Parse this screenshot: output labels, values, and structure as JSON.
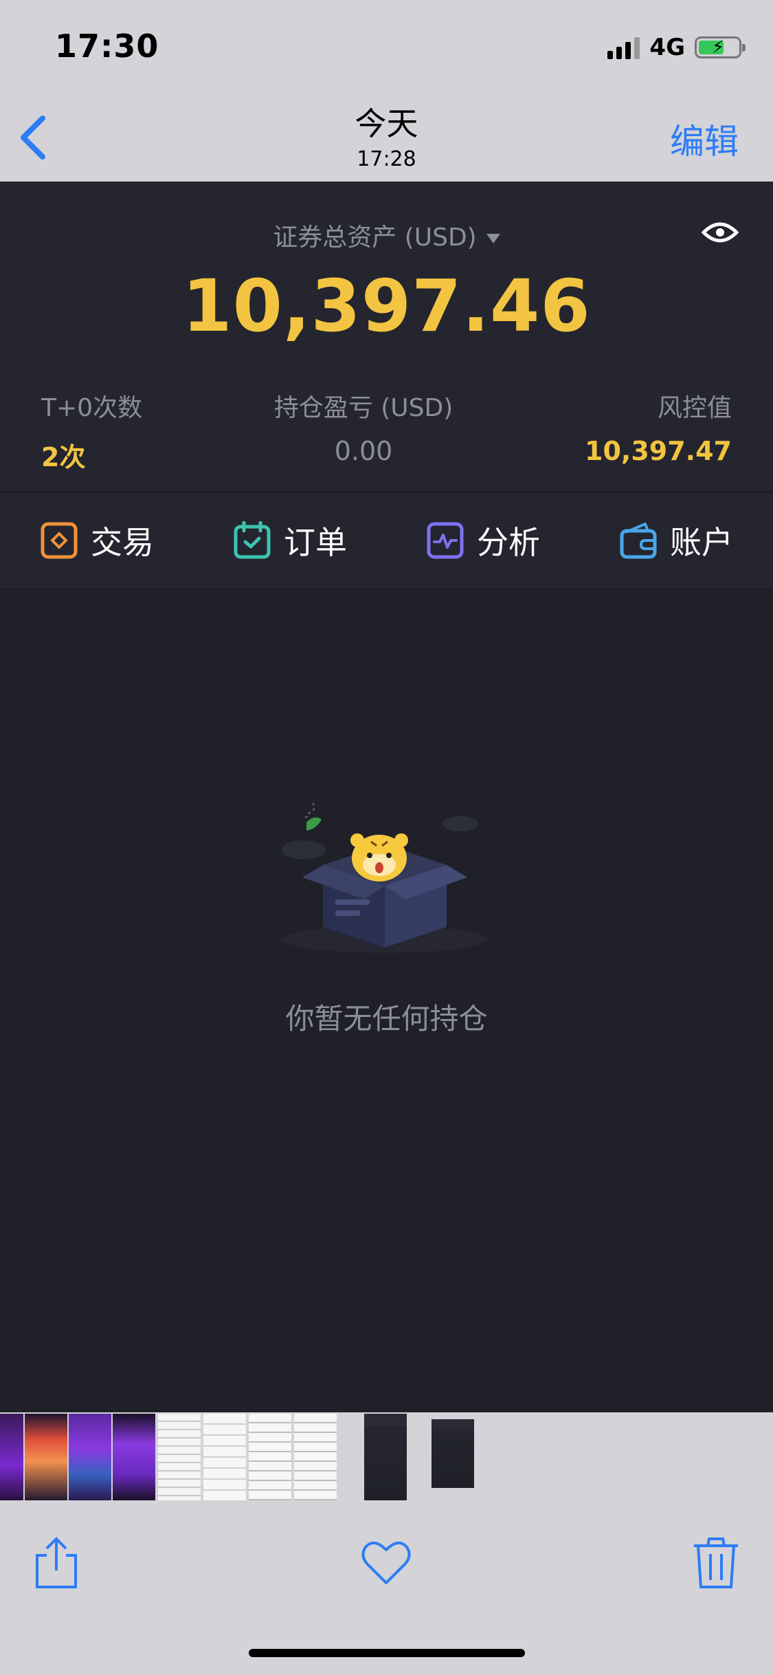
{
  "status_bar": {
    "time": "17:30",
    "network": "4G"
  },
  "photos_nav": {
    "title": "今天",
    "subtitle": "17:28",
    "edit_label": "编辑"
  },
  "account": {
    "asset_label": "证券总资产 (USD)",
    "total_assets": "10,397.46",
    "stats": [
      {
        "label": "T+0次数",
        "value": "2次"
      },
      {
        "label": "持仓盈亏 (USD)",
        "value": "0.00"
      },
      {
        "label": "风控值",
        "value": "10,397.47"
      }
    ]
  },
  "actions": [
    {
      "label": "交易",
      "icon": "trade-icon",
      "color": "#f0923a"
    },
    {
      "label": "订单",
      "icon": "order-calendar-icon",
      "color": "#3cc4b0"
    },
    {
      "label": "分析",
      "icon": "analysis-pulse-icon",
      "color": "#7b73f0"
    },
    {
      "label": "账户",
      "icon": "wallet-icon",
      "color": "#4aa6e8"
    }
  ],
  "empty_state": {
    "message": "你暂无任何持仓",
    "icon": "tiger-in-box-illustration"
  },
  "toolbar_icons": [
    "share-icon",
    "heart-icon",
    "trash-icon"
  ],
  "colors": {
    "accent_yellow": "#f3c441",
    "ios_blue": "#2e7cf6",
    "app_bg": "#1f2028"
  }
}
